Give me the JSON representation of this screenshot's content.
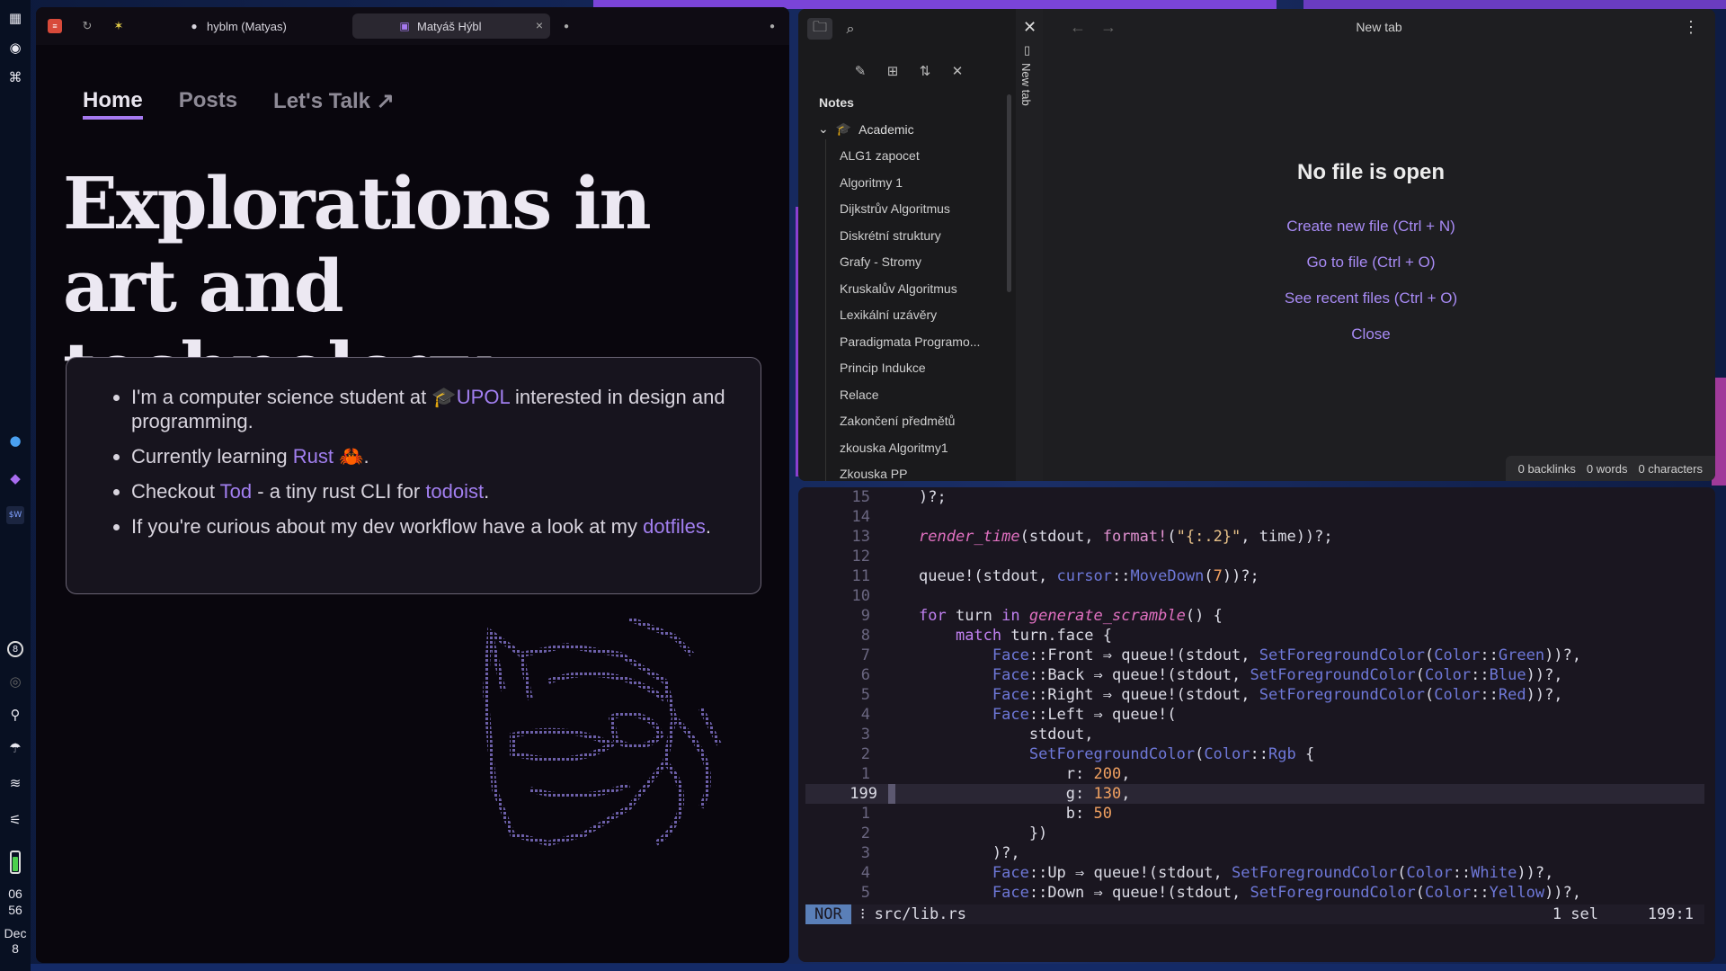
{
  "browser": {
    "tabs": [
      {
        "label": "hyblm (Matyas)",
        "icon": "github-icon"
      },
      {
        "label": "Matyáš Hýbl",
        "icon": "site-icon"
      }
    ],
    "nav": {
      "home": "Home",
      "posts": "Posts",
      "talk": "Let's Talk ↗"
    },
    "hero": "Explorations in art and technology",
    "bullets": {
      "b1_pre": "I'm a computer science student at ",
      "b1_icon": "🎓",
      "b1_link": "UPOL",
      "b1_post": " interested in design and programming.",
      "b2_pre": "Currently learning ",
      "b2_link": "Rust",
      "b2_icon": "🦀",
      "b2_post": ".",
      "b3_pre": "Checkout ",
      "b3_link": "Tod",
      "b3_mid": " - a tiny rust CLI for ",
      "b3_link2": "todoist",
      "b3_post": ".",
      "b4_pre": "If you're curious about my dev workflow have a look at my ",
      "b4_link": "dotfiles",
      "b4_post": "."
    }
  },
  "dock": {
    "badge": "8",
    "time_h": "06",
    "time_m": "56",
    "date_mon": "Dec",
    "date_day": "8"
  },
  "obsidian": {
    "vault": "Notes",
    "folder": "Academic",
    "files": [
      "ALG1 zapocet",
      "Algoritmy 1",
      "Dijkstrův Algoritmus",
      "Diskrétní struktury",
      "Grafy - Stromy",
      "Kruskalův Algoritmus",
      "Lexikální uzávěry",
      "Paradigmata Programo...",
      "Princip Indukce",
      "Relace",
      "Zakončení předmětů",
      "zkouska Algoritmy1",
      "Zkouska PP"
    ],
    "vertical_tab": "New tab",
    "title": "New tab",
    "empty_title": "No file is open",
    "actions": [
      "Create new file (Ctrl + N)",
      "Go to file (Ctrl + O)",
      "See recent files (Ctrl + O)",
      "Close"
    ],
    "status": {
      "backlinks": "0 backlinks",
      "words": "0 words",
      "chars": "0 characters"
    }
  },
  "editor": {
    "mode": "NOR",
    "file": "src/lib.rs",
    "sel": "1 sel",
    "pos": "199:1",
    "line_numbers": [
      "15",
      "14",
      "13",
      "12",
      "11",
      "10",
      "9",
      "8",
      "7",
      "6",
      "5",
      "4",
      "3",
      "2",
      "1",
      "199",
      "1",
      "2",
      "3",
      "4",
      "5"
    ]
  },
  "colors": {
    "accent": "#a679f0",
    "link": "#a27ff0",
    "obs_link": "#a88bf5"
  }
}
